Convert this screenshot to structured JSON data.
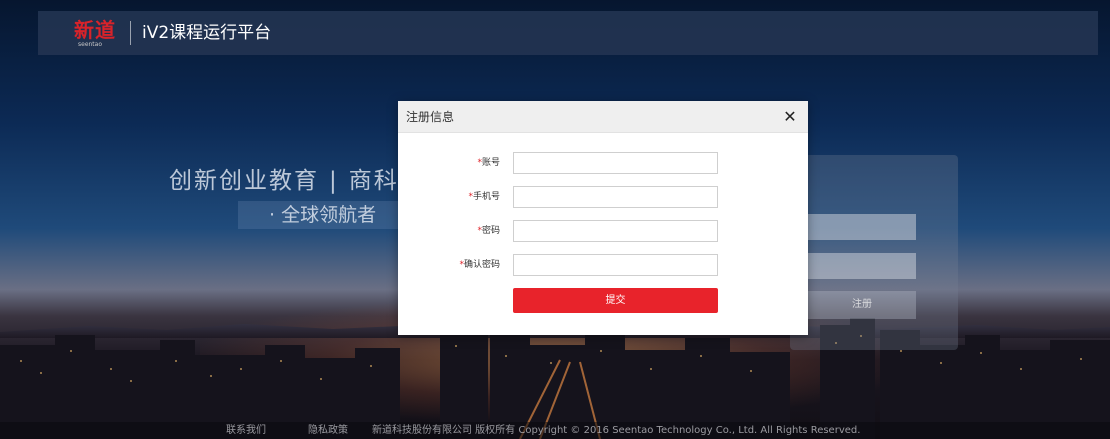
{
  "header": {
    "logo_text": "新道",
    "logo_subtext": "seentao",
    "app_title": "iV2课程运行平台"
  },
  "hero": {
    "slogan_left": "创新创业教育",
    "slogan_separator": "|",
    "slogan_right": "商科",
    "subslogan": "· 全球领航者"
  },
  "login_panel": {
    "register_label": "注册"
  },
  "modal": {
    "title": "注册信息",
    "close_symbol": "✕",
    "required_mark": "*",
    "fields": [
      {
        "label": "账号",
        "value": "",
        "placeholder": ""
      },
      {
        "label": "手机号",
        "value": "",
        "placeholder": ""
      },
      {
        "label": "密码",
        "value": "",
        "placeholder": ""
      },
      {
        "label": "确认密码",
        "value": "",
        "placeholder": ""
      }
    ],
    "submit_label": "提交"
  },
  "footer": {
    "contact": "联系我们",
    "privacy": "隐私政策",
    "copyright": "新道科技股份有限公司 版权所有 Copyright © 2016 Seentao Technology Co., Ltd. All Rights Reserved."
  },
  "colors": {
    "accent": "#e8232b",
    "brand_red": "#d8232a",
    "header_bg": "#233452"
  }
}
